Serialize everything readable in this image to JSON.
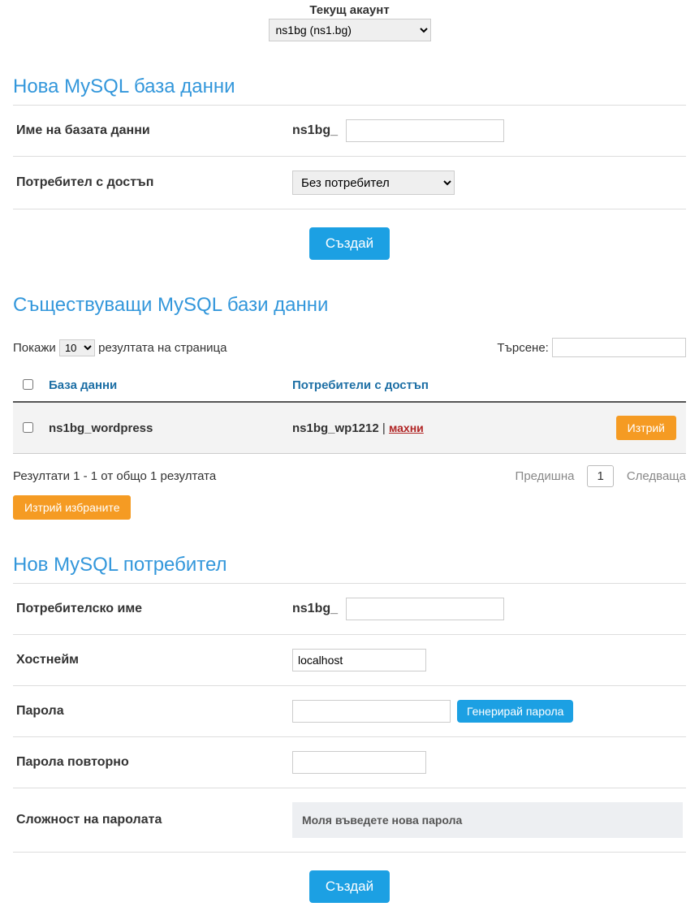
{
  "account": {
    "label": "Текущ акаунт",
    "selected": "ns1bg (ns1.bg)"
  },
  "sections": {
    "newdb": {
      "title": "Нова MySQL база данни"
    },
    "existing": {
      "title": "Съществуващи MySQL бази данни"
    },
    "newuser": {
      "title": "Нов MySQL потребител"
    }
  },
  "newdb": {
    "name_label": "Име на базата данни",
    "prefix": "ns1bg_",
    "user_label": "Потребител с достъп",
    "user_selected": "Без потребител",
    "create_btn": "Създай"
  },
  "table": {
    "show_before": "Покажи",
    "per_page": "10",
    "show_after": "резултата на страница",
    "search_label": "Търсене:",
    "col_db": "База данни",
    "col_users": "Потребители с достъп",
    "rows": [
      {
        "db": "ns1bg_wordpress",
        "user": "ns1bg_wp1212",
        "remove": "махни",
        "delete": "Изтрий"
      }
    ],
    "results_text": "Резултати 1 - 1 от общо 1 резултата",
    "prev": "Предишна",
    "page": "1",
    "next": "Следваща",
    "delete_selected": "Изтрий избраните"
  },
  "newuser": {
    "username_label": "Потребителско име",
    "prefix": "ns1bg_",
    "host_label": "Хостнейм",
    "host_value": "localhost",
    "pass_label": "Парола",
    "pass_gen": "Генерирай парола",
    "pass2_label": "Парола повторно",
    "complexity_label": "Сложност на паролата",
    "complexity_msg": "Моля въведете нова парола",
    "create_btn": "Създай"
  }
}
